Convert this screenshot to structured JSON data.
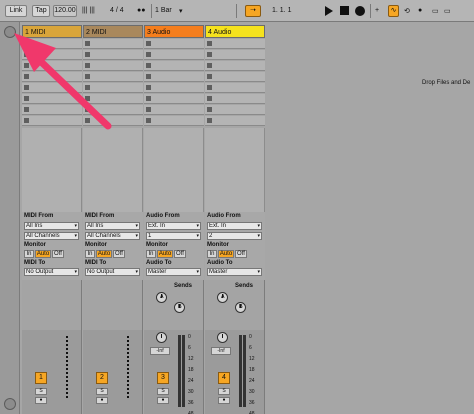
{
  "transport": {
    "link": "Link",
    "tap": "Tap",
    "tempo": "120.00",
    "time_sig": "4 / 4",
    "quantize": "1 Bar",
    "position": "1.   1.   1"
  },
  "tracks": [
    {
      "name": "1 MIDI",
      "color": "#d9a53a",
      "type": "midi",
      "from_label": "MIDI From",
      "from_value": "All Ins",
      "channel": "All Channels",
      "monitor_label": "Monitor",
      "to_label": "MIDI To",
      "to_value": "No Output",
      "number": "1"
    },
    {
      "name": "2 MIDI",
      "color": "#a9885c",
      "type": "midi",
      "from_label": "MIDI From",
      "from_value": "All Ins",
      "channel": "All Channels",
      "monitor_label": "Monitor",
      "to_label": "MIDI To",
      "to_value": "No Output",
      "number": "2"
    },
    {
      "name": "3 Audio",
      "color": "#f57e1d",
      "type": "audio",
      "from_label": "Audio From",
      "from_value": "Ext. In",
      "channel": "1",
      "monitor_label": "Monitor",
      "to_label": "Audio To",
      "to_value": "Master",
      "number": "3"
    },
    {
      "name": "4 Audio",
      "color": "#f5e21d",
      "type": "audio",
      "from_label": "Audio From",
      "from_value": "Ext. In",
      "channel": "2",
      "monitor_label": "Monitor",
      "to_label": "Audio To",
      "to_value": "Master",
      "number": "4"
    }
  ],
  "monitor_options": [
    "In",
    "Auto",
    "Off"
  ],
  "sends_label": "Sends",
  "send_a": "A",
  "send_b": "B",
  "inf_label": "-Inf",
  "fader_scale": [
    "0",
    "6",
    "12",
    "18",
    "24",
    "30",
    "36",
    "48",
    "60"
  ],
  "drop_text": "Drop Files and De",
  "colors": {
    "accent": "#f6a623",
    "arrow": "#f0386b"
  }
}
